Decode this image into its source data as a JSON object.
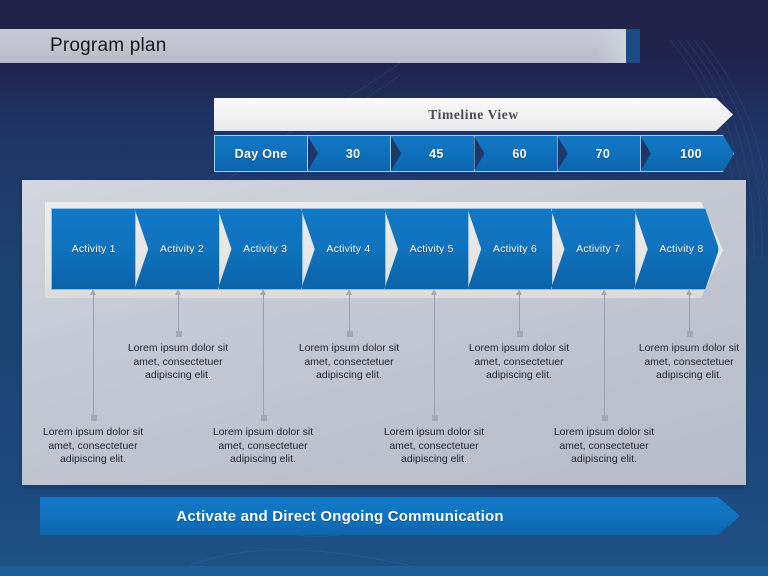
{
  "slide": {
    "title": "Program plan",
    "accent_color": "#1c4c86",
    "brand_blue": "#0f72bd",
    "background_dark": "#20224a",
    "background_blue": "#1d4a7e"
  },
  "timeline": {
    "banner_label": "Timeline  View",
    "segments": [
      {
        "label": "Day One"
      },
      {
        "label": "30"
      },
      {
        "label": "45"
      },
      {
        "label": "60"
      },
      {
        "label": "70"
      },
      {
        "label": "100"
      }
    ]
  },
  "activities": [
    {
      "label": "Activity 1"
    },
    {
      "label": "Activity 2"
    },
    {
      "label": "Activity 3"
    },
    {
      "label": "Activity 4"
    },
    {
      "label": "Activity 5"
    },
    {
      "label": "Activity 6"
    },
    {
      "label": "Activity 7"
    },
    {
      "label": "Activity 8"
    }
  ],
  "notes": [
    {
      "text": "Lorem ipsum dolor sit amet, consectetuer adipiscing elit."
    },
    {
      "text": "Lorem ipsum dolor sit amet, consectetuer adipiscing elit."
    },
    {
      "text": "Lorem ipsum dolor sit amet, consectetuer adipiscing elit."
    },
    {
      "text": "Lorem ipsum dolor sit amet, consectetuer adipiscing elit."
    },
    {
      "text": "Lorem ipsum dolor sit amet, consectetuer adipiscing elit."
    },
    {
      "text": "Lorem ipsum dolor sit amet, consectetuer adipiscing elit."
    },
    {
      "text": "Lorem ipsum dolor sit amet, consectetuer adipiscing elit."
    },
    {
      "text": "Lorem ipsum dolor sit amet, consectetuer adipiscing elit."
    }
  ],
  "footer": {
    "banner_label": "Activate and Direct Ongoing Communication"
  }
}
